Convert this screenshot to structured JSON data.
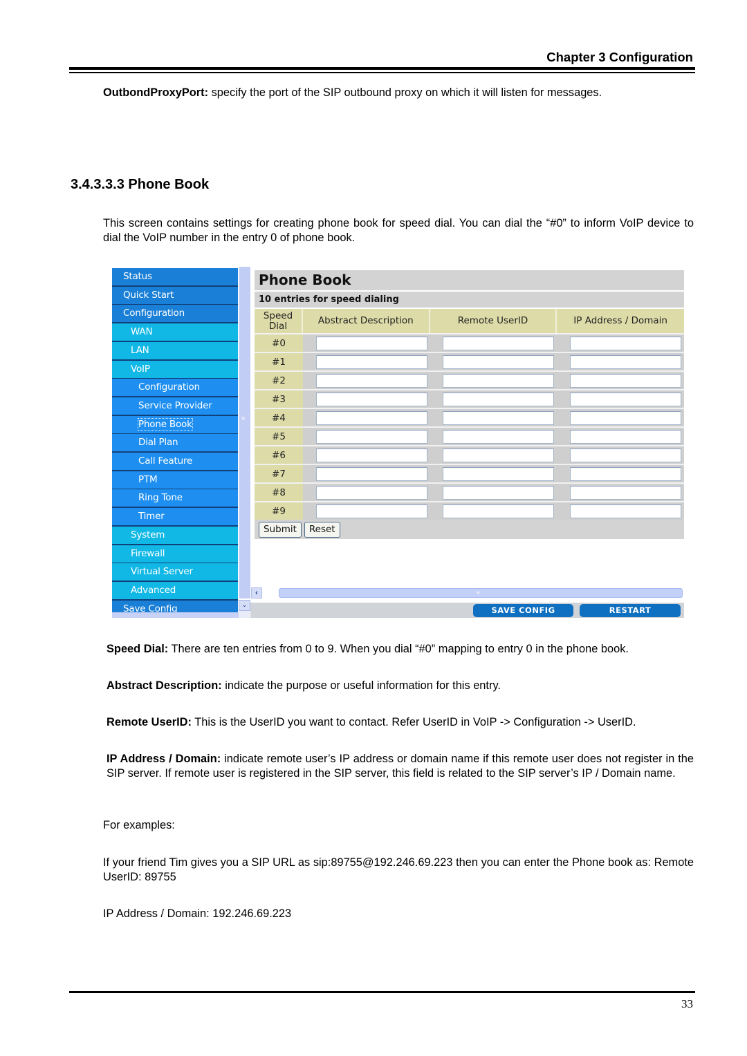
{
  "header": {
    "chapter_title": "Chapter 3 Configuration"
  },
  "intro_param": {
    "term": "OutbondProxyPort:",
    "text": " specify the port of the SIP outbound proxy on which it will listen for messages."
  },
  "section": {
    "heading": "3.4.3.3.3 Phone Book",
    "description": "This screen contains settings for creating phone book for speed dial. You can dial the “#0” to inform VoIP device to dial the VoIP number in the entry 0 of phone book."
  },
  "screenshot": {
    "sidebar": {
      "items": [
        {
          "label": "Status",
          "level": 0
        },
        {
          "label": "Quick Start",
          "level": 0
        },
        {
          "label": "Configuration",
          "level": 0
        },
        {
          "label": "WAN",
          "level": 1
        },
        {
          "label": "LAN",
          "level": 1
        },
        {
          "label": "VoIP",
          "level": 1
        },
        {
          "label": "Configuration",
          "level": 2
        },
        {
          "label": "Service Provider",
          "level": 2
        },
        {
          "label": "Phone Book",
          "level": 2,
          "focused": true
        },
        {
          "label": "Dial Plan",
          "level": 2
        },
        {
          "label": "Call Feature",
          "level": 2
        },
        {
          "label": "PTM",
          "level": 2
        },
        {
          "label": "Ring Tone",
          "level": 2
        },
        {
          "label": "Timer",
          "level": 2
        },
        {
          "label": "System",
          "level": 1
        },
        {
          "label": "Firewall",
          "level": 1
        },
        {
          "label": "Virtual Server",
          "level": 1
        },
        {
          "label": "Advanced",
          "level": 1
        },
        {
          "label": "Save Config",
          "level": 0
        }
      ]
    },
    "panel": {
      "title": "Phone Book",
      "subtitle": "10 entries for speed dialing",
      "columns": [
        "Speed Dial",
        "Abstract Description",
        "Remote UserID",
        "IP Address / Domain"
      ],
      "rows": [
        {
          "speed_dial": "#0",
          "description": "",
          "remote_userid": "",
          "ip_domain": ""
        },
        {
          "speed_dial": "#1",
          "description": "",
          "remote_userid": "",
          "ip_domain": ""
        },
        {
          "speed_dial": "#2",
          "description": "",
          "remote_userid": "",
          "ip_domain": ""
        },
        {
          "speed_dial": "#3",
          "description": "",
          "remote_userid": "",
          "ip_domain": ""
        },
        {
          "speed_dial": "#4",
          "description": "",
          "remote_userid": "",
          "ip_domain": ""
        },
        {
          "speed_dial": "#5",
          "description": "",
          "remote_userid": "",
          "ip_domain": ""
        },
        {
          "speed_dial": "#6",
          "description": "",
          "remote_userid": "",
          "ip_domain": ""
        },
        {
          "speed_dial": "#7",
          "description": "",
          "remote_userid": "",
          "ip_domain": ""
        },
        {
          "speed_dial": "#8",
          "description": "",
          "remote_userid": "",
          "ip_domain": ""
        },
        {
          "speed_dial": "#9",
          "description": "",
          "remote_userid": "",
          "ip_domain": ""
        }
      ],
      "submit_label": "Submit",
      "reset_label": "Reset"
    },
    "footer": {
      "save_config_label": "SAVE CONFIG",
      "restart_label": "RESTART"
    },
    "icons": {
      "scroll_left": "‹",
      "scroll_down": "⌄",
      "grip": "≡"
    }
  },
  "definitions": [
    {
      "term": "Speed Dial:",
      "text": " There are ten entries from 0 to 9. When you dial “#0” mapping to entry 0 in the phone book."
    },
    {
      "term": "Abstract Description:",
      "text": " indicate the purpose or useful information for this entry."
    },
    {
      "term": "Remote UserID:",
      "text": " This is the UserID you want to contact. Refer UserID in VoIP -> Configuration -> UserID."
    },
    {
      "term": "IP Address / Domain:",
      "text": " indicate remote user’s IP address or domain name if this remote user does not register in the SIP server. If remote user is registered in the SIP server, this field is related to the SIP server’s IP / Domain name."
    }
  ],
  "examples": {
    "label": "For examples:",
    "line1": "If your friend Tim gives you a SIP URL as sip:89755@192.246.69.223 then you can enter the Phone book as: Remote UserID: 89755",
    "line2": "IP Address / Domain: 192.246.69.223"
  },
  "page_number": "33"
}
